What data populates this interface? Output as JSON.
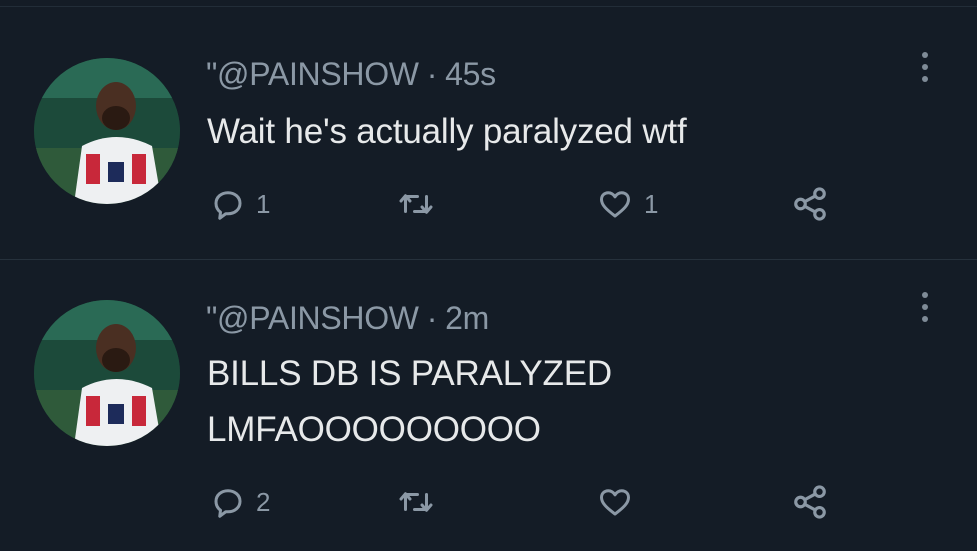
{
  "tweets": [
    {
      "handle": "\"@PAINSHOW",
      "separator": "·",
      "time": "45s",
      "lines": [
        "Wait he's actually paralyzed wtf"
      ],
      "reply_count": "1",
      "retweet_count": "",
      "like_count": "1"
    },
    {
      "handle": "\"@PAINSHOW",
      "separator": "·",
      "time": "2m",
      "lines": [
        "BILLS DB IS PARALYZED",
        "LMFAOOOOOOOOO"
      ],
      "reply_count": "2",
      "retweet_count": "",
      "like_count": ""
    }
  ],
  "icons": {
    "avatar": "profile-photo-football-player",
    "more": "vertical-ellipsis-icon",
    "reply": "reply-bubble-icon",
    "retweet": "retweet-icon",
    "like": "heart-icon",
    "share": "share-nodes-icon"
  },
  "colors": {
    "background": "#141c26",
    "text": "#e7e9ea",
    "muted": "#8b98a5"
  }
}
